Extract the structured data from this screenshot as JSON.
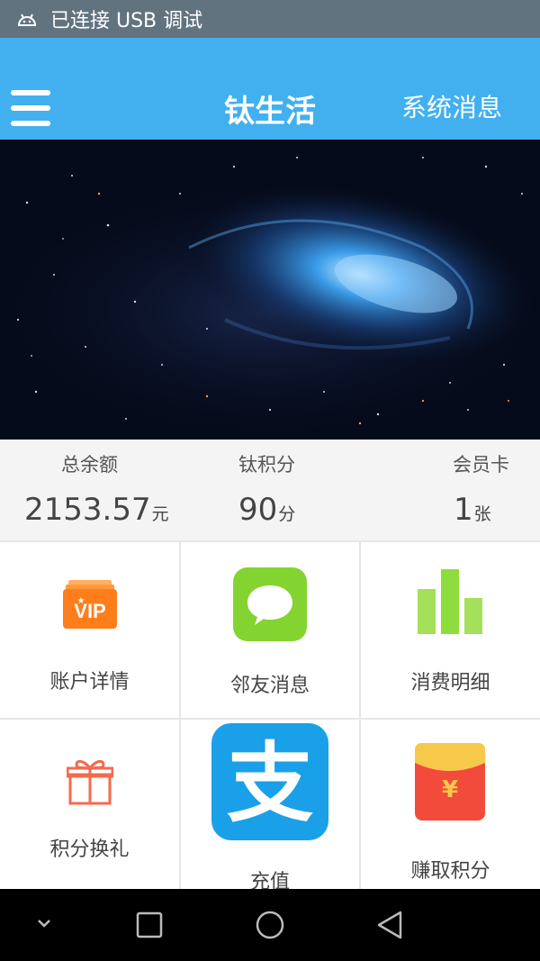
{
  "status_bar": {
    "text": "已连接 USB 调试"
  },
  "app_bar": {
    "title": "钛生活",
    "right_action": "系统消息"
  },
  "stats": [
    {
      "label": "总余额",
      "value": "2153.57",
      "unit": "元"
    },
    {
      "label": "钛积分",
      "value": "90",
      "unit": "分"
    },
    {
      "label": "会员卡",
      "value": "1",
      "unit": "张"
    }
  ],
  "grid": [
    {
      "label": "账户详情",
      "icon": "vip-card-icon",
      "color": "#ff7d1a"
    },
    {
      "label": "邻友消息",
      "icon": "chat-bubble-icon",
      "color": "#84d431"
    },
    {
      "label": "消费明细",
      "icon": "bar-chart-icon",
      "color": "#8fdc3d"
    },
    {
      "label": "积分换礼",
      "icon": "gift-icon",
      "color": "#f46a4e"
    },
    {
      "label": "充值",
      "icon": "alipay-icon",
      "color": "#1aa0e8"
    },
    {
      "label": "赚取积分",
      "icon": "red-packet-icon",
      "color": "#f24a3b"
    }
  ],
  "nav_bar": {
    "icons": [
      "chevron-down-icon",
      "recents-square-icon",
      "home-circle-icon",
      "back-triangle-icon"
    ]
  }
}
